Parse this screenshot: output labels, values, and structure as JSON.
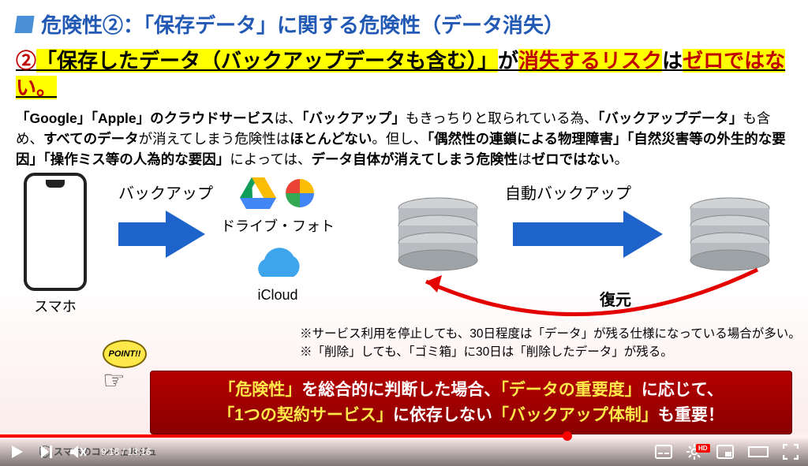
{
  "title": "危険性②：「保存データ」に関する危険性（データ消失）",
  "heading": {
    "num": "②",
    "h1": "「保存したデータ（バックアップデータも含む）」",
    "mid": "が",
    "h2": "消失するリスク",
    "mid2": "は",
    "h3": "ゼロではない。"
  },
  "body": {
    "line1a": "「Google」「Apple」のクラウドサービス",
    "line1b": "は、",
    "line1c": "「バックアップ」",
    "line1d": "もきっちりと取られている為、",
    "line1e": "「バックアップデータ」",
    "line1f": "も含め、",
    "line1g": "すべてのデータ",
    "line1h": "が消えてしまう危険性は",
    "line1i": "ほとんどない",
    "line1j": "。但し、",
    "line1k": "「偶然性の連鎖による物理障害」「自然災害等の外生的な要因」「操作ミス等の人為的な要因」",
    "line1l": "によっては、",
    "line1m": "データ自体が消えてしまう危険性",
    "line1n": "は",
    "line1o": "ゼロではない",
    "line1p": "。"
  },
  "diagram": {
    "phone": "スマホ",
    "backup": "バックアップ",
    "drive_photo": "ドライブ・フォト",
    "icloud": "iCloud",
    "auto_backup": "自動バックアップ",
    "restore": "復元"
  },
  "notes": {
    "n1": "※サービス利用を停止しても、30日程度は「データ」が残る仕様になっている場合が多い。",
    "n2": "※「削除」しても、「ゴミ箱」に30日は「削除したデータ」が残る。"
  },
  "point": "POINT!!",
  "summary": {
    "s1a": "「危険性」",
    "s1b": "を総合的に判断した場合、",
    "s1c": "「データの重要度」",
    "s1d": "に応じて、",
    "s2a": "「1つの契約サービス」",
    "s2b": "に依存しない",
    "s2c": "「バックアップ体制」",
    "s2d": "も重要！"
  },
  "channel": "スマホのコンシェルジュ",
  "player": {
    "current": "9:18",
    "total": "13:16",
    "progress_pct": 70.2
  },
  "colors": {
    "title_blue": "#2159b5",
    "highlight": "#ffff00",
    "red": "#c00000"
  }
}
